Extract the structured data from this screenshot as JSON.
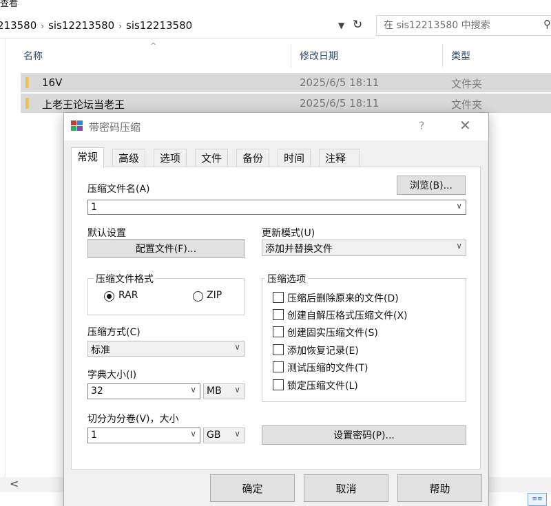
{
  "explorer": {
    "title_fragment": "查看",
    "breadcrumb": [
      "213580",
      "sis12213580",
      "sis12213580"
    ],
    "search_placeholder": "在 sis12213580 中搜索",
    "columns": {
      "name": "名称",
      "date": "修改日期",
      "type": "类型"
    },
    "rows": [
      {
        "name": "16V",
        "date": "2025/6/5 18:11",
        "type": "文件夹"
      },
      {
        "name": "上老王论坛当老王",
        "date": "2025/6/5 18:11",
        "type": "文件夹"
      }
    ]
  },
  "dialog": {
    "title": "带密码压缩",
    "help": "?",
    "close": "✕",
    "tabs": [
      "常规",
      "高级",
      "选项",
      "文件",
      "备份",
      "时间",
      "注释"
    ],
    "archive_name_label": "压缩文件名(A)",
    "archive_name_value": "1",
    "browse_button": "浏览(B)...",
    "default_settings_label": "默认设置",
    "profile_button": "配置文件(F)...",
    "update_mode_label": "更新模式(U)",
    "update_mode_value": "添加并替换文件",
    "format_group": "压缩文件格式",
    "format_rar": "RAR",
    "format_zip": "ZIP",
    "method_label": "压缩方式(C)",
    "method_value": "标准",
    "dict_label": "字典大小(I)",
    "dict_value": "32",
    "dict_unit": "MB",
    "split_label": "切分为分卷(V)，大小",
    "split_value": "1",
    "split_unit": "GB",
    "options_group": "压缩选项",
    "options": [
      "压缩后删除原来的文件(D)",
      "创建自解压格式压缩文件(X)",
      "创建固实压缩文件(S)",
      "添加恢复记录(E)",
      "测试压缩的文件(T)",
      "锁定压缩文件(L)"
    ],
    "set_password_button": "设置密码(P)...",
    "ok_button": "确定",
    "cancel_button": "取消",
    "help_button": "帮助"
  }
}
